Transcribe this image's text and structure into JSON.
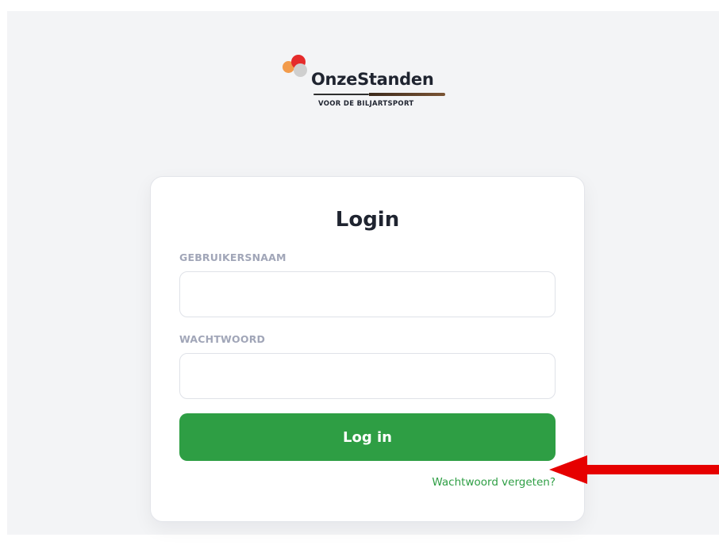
{
  "brand": {
    "name": "OnzeStanden",
    "tagline": "VOOR DE BILJARTSPORT"
  },
  "login": {
    "title": "Login",
    "username_label": "GEBRUIKERSNAAM",
    "username_value": "",
    "password_label": "WACHTWOORD",
    "password_value": "",
    "submit_label": "Log in",
    "forgot_label": "Wachtwoord vergeten?"
  },
  "colors": {
    "accent": "#2e9e44",
    "page_background": "#f3f4f6",
    "title_text": "#1f2430",
    "label_text": "#a1a6b8",
    "arrow": "#e60000"
  },
  "icons": {
    "logo_mark": "overlapping-circles-icon",
    "logo_cue": "billiard-cue-icon",
    "annotation": "red-arrow-icon"
  }
}
